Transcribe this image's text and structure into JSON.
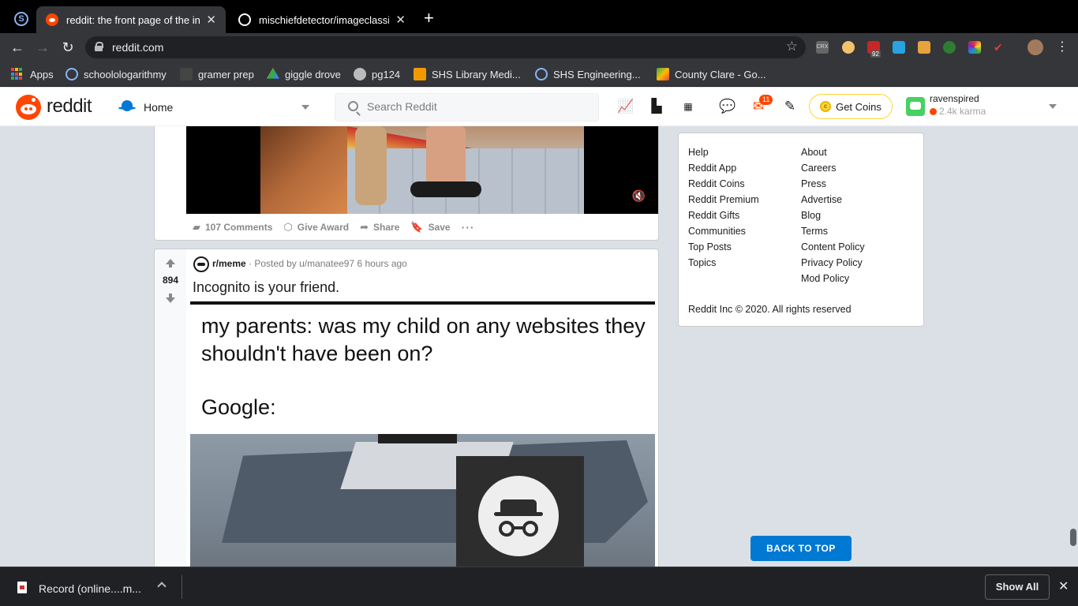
{
  "browser": {
    "tabs": [
      {
        "title": "reddit: the front page of the int",
        "active": true,
        "icon": "reddit-favicon"
      },
      {
        "title": "mischiefdetector/imageclassifi",
        "active": false,
        "icon": "github-favicon"
      }
    ],
    "url": "reddit.com",
    "bookmarks": [
      {
        "label": "Apps",
        "icon": "apps-grid-icon"
      },
      {
        "label": "schoolologarithmy",
        "icon": "schoology-icon"
      },
      {
        "label": "gramer prep",
        "icon": "grammar-icon"
      },
      {
        "label": "giggle drove",
        "icon": "google-drive-icon"
      },
      {
        "label": "pg124",
        "icon": "globe-icon"
      },
      {
        "label": "SHS Library Medi...",
        "icon": "library-icon"
      },
      {
        "label": "SHS Engineering...",
        "icon": "schoology-icon"
      },
      {
        "label": "County Clare - Go...",
        "icon": "maps-icon"
      }
    ],
    "extension_badge": "92"
  },
  "reddit_header": {
    "wordmark": "reddit",
    "feed": "Home",
    "search_placeholder": "Search Reddit",
    "mail_badge": "11",
    "get_coins": "Get Coins",
    "username": "ravenspired",
    "karma": "2.4k karma"
  },
  "post1": {
    "actions": {
      "comments": "107 Comments",
      "award": "Give Award",
      "share": "Share",
      "save": "Save",
      "more": "···"
    }
  },
  "post2": {
    "votes": "894",
    "subreddit": "r/meme",
    "meta": "· Posted by u/manatee97 6 hours ago",
    "title": "Incognito is your friend.",
    "meme_text": "my parents: was my child on any websites they shouldn't have been on?",
    "meme_text2": "Google:"
  },
  "sidebar": {
    "links_left": [
      "Help",
      "Reddit App",
      "Reddit Coins",
      "Reddit Premium",
      "Reddit Gifts",
      "Communities",
      "Top Posts",
      "Topics"
    ],
    "links_right": [
      "About",
      "Careers",
      "Press",
      "Advertise",
      "Blog",
      "Terms",
      "Content Policy",
      "Privacy Policy",
      "Mod Policy"
    ],
    "copyright": "Reddit Inc © 2020. All rights reserved",
    "back_to_top": "BACK TO TOP"
  },
  "download_shelf": {
    "file": "Record (online....m...",
    "show_all": "Show All"
  }
}
